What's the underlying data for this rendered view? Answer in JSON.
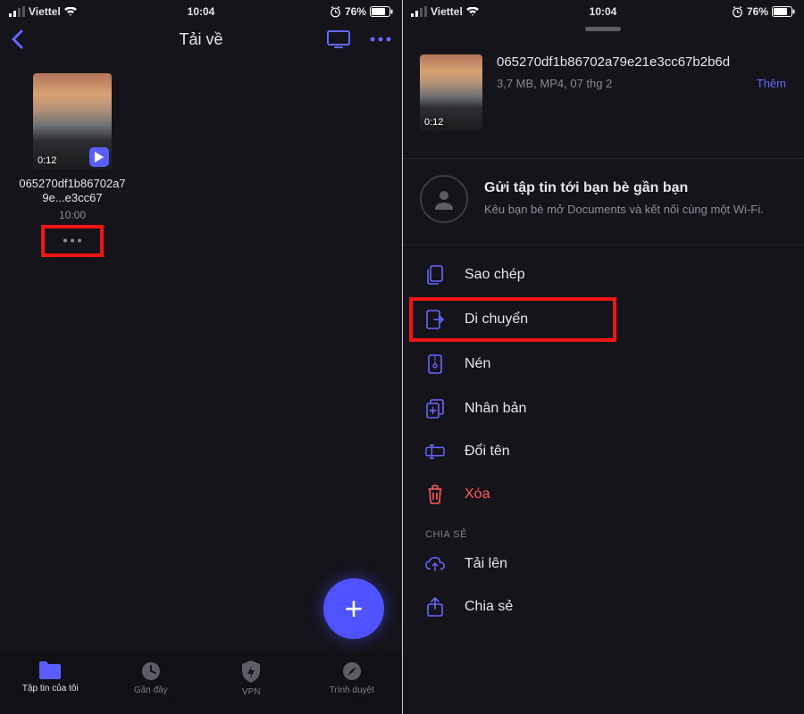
{
  "status_bar": {
    "carrier": "Viettel",
    "time": "10:04",
    "alarm_icon": "alarm-icon",
    "battery_pct": "76%"
  },
  "left": {
    "nav": {
      "title": "Tải về"
    },
    "file": {
      "duration": "0:12",
      "name": "065270df1b86702a79e...e3cc67",
      "time": "10:00"
    },
    "tabs": [
      {
        "label": "Tập tin của tôi"
      },
      {
        "label": "Gần đây"
      },
      {
        "label": "VPN"
      },
      {
        "label": "Trình duyệt"
      }
    ]
  },
  "right": {
    "file": {
      "duration": "0:12",
      "name": "065270df1b86702a79e21e3cc67b2b6d",
      "subtitle": "3,7 MB, MP4, 07 thg 2",
      "more": "Thêm"
    },
    "share_card": {
      "title": "Gửi tập tin tới bạn bè gần bạn",
      "desc": "Kêu bạn bè mở Documents và kết nối cùng một Wi-Fi."
    },
    "actions": [
      {
        "label": "Sao chép"
      },
      {
        "label": "Di chuyển"
      },
      {
        "label": "Nén"
      },
      {
        "label": "Nhân bản"
      },
      {
        "label": "Đổi tên"
      },
      {
        "label": "Xóa"
      }
    ],
    "share_section_label": "CHIA SẺ",
    "share_actions": [
      {
        "label": "Tải lên"
      },
      {
        "label": "Chia sẻ"
      }
    ]
  }
}
